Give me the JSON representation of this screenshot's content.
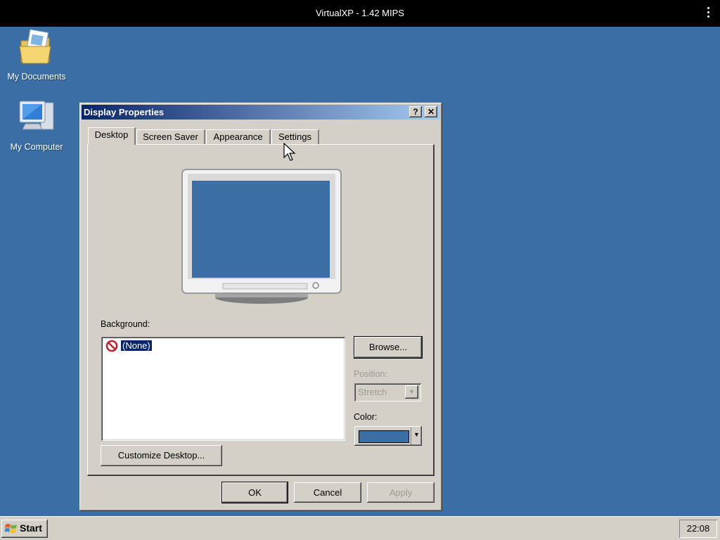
{
  "emulator": {
    "title": "VirtualXP - 1.42 MIPS",
    "menu_icon": "more-vert-icon"
  },
  "desktop": {
    "background_color": "#3a6ea5",
    "icons": [
      {
        "label": "My Documents",
        "icon": "folder-documents-icon"
      },
      {
        "label": "My Computer",
        "icon": "computer-icon"
      }
    ]
  },
  "dialog": {
    "title": "Display Properties",
    "help_label": "?",
    "close_label": "✕",
    "tabs": [
      "Desktop",
      "Screen Saver",
      "Appearance",
      "Settings"
    ],
    "active_tab": "Desktop",
    "preview_color": "#3a6ea5",
    "background_label": "Background:",
    "background_items": [
      {
        "label": "(None)",
        "icon": "none-icon",
        "selected": true
      }
    ],
    "browse_label": "Browse...",
    "position_label": "Position:",
    "position_value": "Stretch",
    "color_label": "Color:",
    "color_value": "#3a6ea5",
    "customize_label": "Customize Desktop...",
    "ok_label": "OK",
    "cancel_label": "Cancel",
    "apply_label": "Apply"
  },
  "taskbar": {
    "start_label": "Start",
    "clock": "22:08"
  }
}
